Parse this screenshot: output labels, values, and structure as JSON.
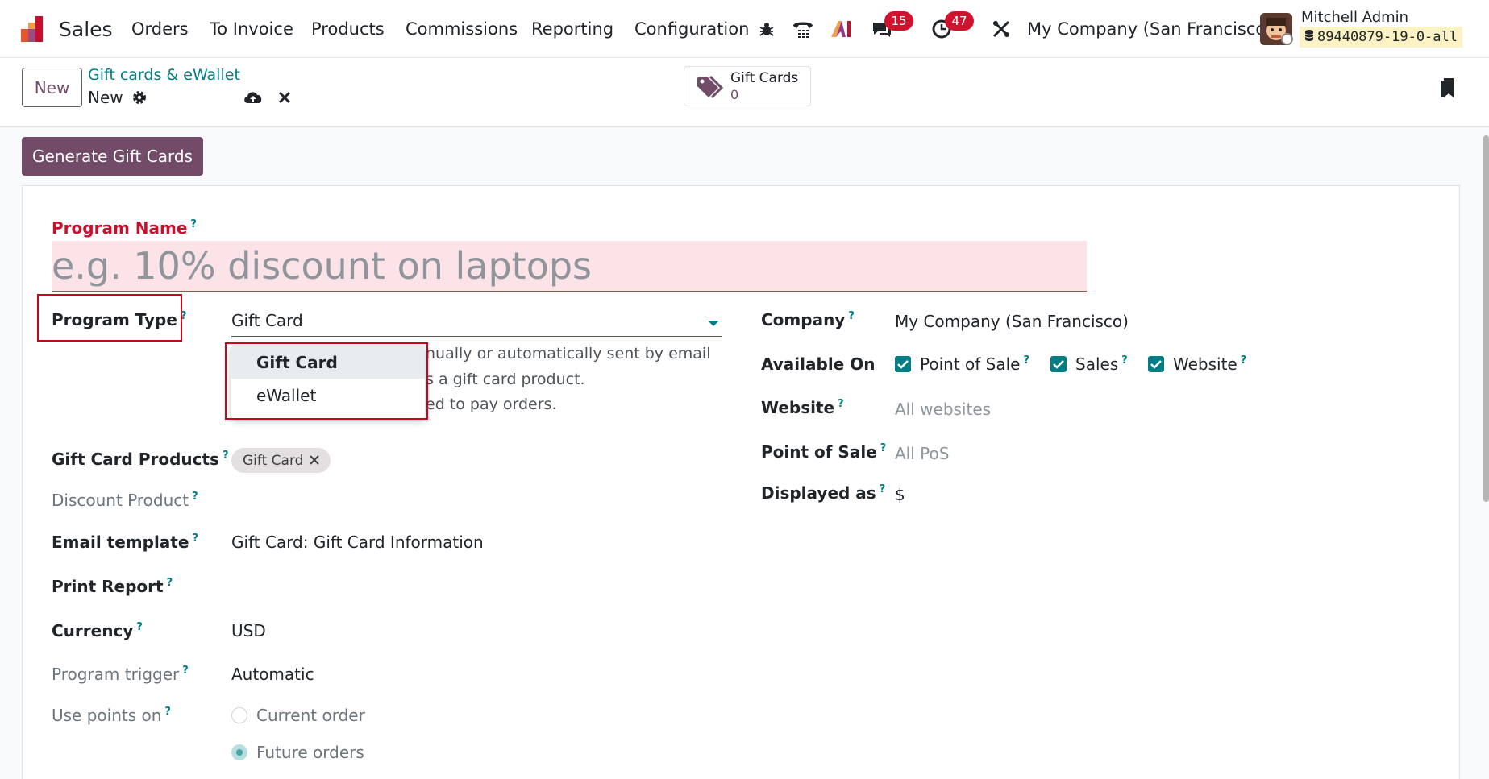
{
  "navbar": {
    "app_name": "Sales",
    "menu": [
      "Orders",
      "To Invoice",
      "Products",
      "Commissions",
      "Reporting",
      "Configuration"
    ],
    "messages_count": "15",
    "activities_count": "47",
    "company": "My Company (San Francisco)",
    "user_name": "Mitchell Admin",
    "database": "89440879-19-0-all"
  },
  "control": {
    "new_label": "New",
    "breadcrumb": "Gift cards & eWallet",
    "record_name": "New",
    "smart_button": {
      "label": "Gift Cards",
      "value": "0"
    }
  },
  "form": {
    "generate_label": "Generate Gift Cards",
    "program_name_label": "Program Name",
    "program_name_placeholder": "e.g. 10% discount on laptops",
    "program_type_label": "Program Type",
    "program_type_value": "Gift Card",
    "program_type_options": [
      "Gift Card",
      "eWallet"
    ],
    "description_lines": [
      "nually or automatically sent by email",
      "s a gift card product.",
      "ed to pay orders."
    ],
    "gift_card_products_label": "Gift Card Products",
    "gift_card_products_tag": "Gift Card",
    "discount_product_label": "Discount Product",
    "email_template_label": "Email template",
    "email_template_value": "Gift Card: Gift Card Information",
    "print_report_label": "Print Report",
    "currency_label": "Currency",
    "currency_value": "USD",
    "program_trigger_label": "Program trigger",
    "program_trigger_value": "Automatic",
    "use_points_on_label": "Use points on",
    "use_points_options": [
      "Current order",
      "Future orders"
    ],
    "use_points_selected": "Future orders",
    "company_label": "Company",
    "company_value": "My Company (San Francisco)",
    "available_on_label": "Available On",
    "available_on_options": [
      "Point of Sale",
      "Sales",
      "Website"
    ],
    "website_label": "Website",
    "website_placeholder": "All websites",
    "pos_label": "Point of Sale",
    "pos_placeholder": "All PoS",
    "displayed_as_label": "Displayed as",
    "displayed_as_value": "$"
  },
  "colors": {
    "brand": "#714b67",
    "accent": "#017e84",
    "badge": "#d1122f",
    "highlight": "#d0021b"
  }
}
